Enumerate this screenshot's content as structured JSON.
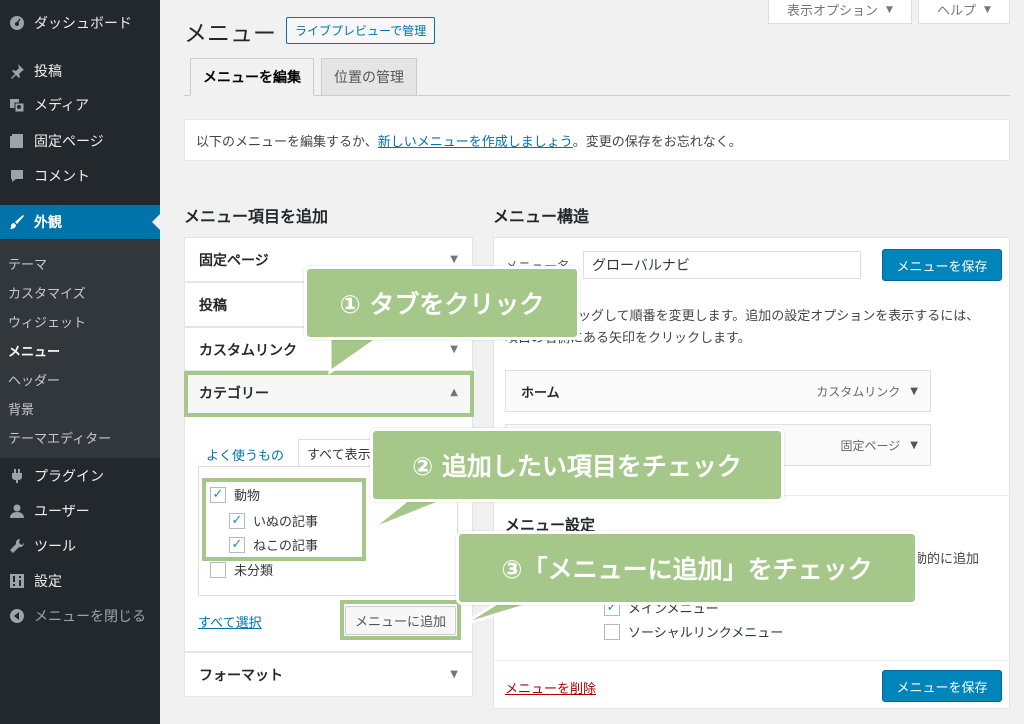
{
  "sidebar": {
    "top_items": [
      {
        "label": "ダッシュボード",
        "icon": "dashboard-icon"
      },
      {
        "label": "投稿",
        "icon": "pin-icon"
      },
      {
        "label": "メディア",
        "icon": "media-icon"
      },
      {
        "label": "固定ページ",
        "icon": "page-icon"
      },
      {
        "label": "コメント",
        "icon": "comment-icon"
      }
    ],
    "active_item": {
      "label": "外観",
      "icon": "brush-icon"
    },
    "submenu": [
      "テーマ",
      "カスタマイズ",
      "ウィジェット",
      "メニュー",
      "ヘッダー",
      "背景",
      "テーマエディター"
    ],
    "current_submenu": "メニュー",
    "bottom_items": [
      {
        "label": "プラグイン",
        "icon": "plugin-icon"
      },
      {
        "label": "ユーザー",
        "icon": "user-icon"
      },
      {
        "label": "ツール",
        "icon": "wrench-icon"
      },
      {
        "label": "設定",
        "icon": "settings-icon"
      },
      {
        "label": "メニューを閉じる",
        "icon": "collapse-icon"
      }
    ]
  },
  "header": {
    "title": "メニュー",
    "live_preview_button": "ライブプレビューで管理",
    "screen_options": "表示オプション",
    "help": "ヘルプ"
  },
  "tabs": {
    "edit": "メニューを編集",
    "locations": "位置の管理"
  },
  "info": {
    "prefix": "以下のメニューを編集するか、",
    "link": "新しいメニューを作成しましょう",
    "suffix": "。変更の保存をお忘れなく。"
  },
  "add_items": {
    "heading": "メニュー項目を追加",
    "sections": [
      "固定ページ",
      "投稿",
      "カスタムリンク",
      "カテゴリー",
      "フォーマット"
    ],
    "inner_tabs": [
      "よく使うもの",
      "すべて表示"
    ],
    "categories": [
      {
        "label": "動物",
        "checked": true
      },
      {
        "label": "いぬの記事",
        "checked": true
      },
      {
        "label": "ねこの記事",
        "checked": true
      },
      {
        "label": "未分類",
        "checked": false
      }
    ],
    "select_all": "すべて選択",
    "add_button": "メニューに追加"
  },
  "structure": {
    "heading": "メニュー構造",
    "name_label": "メニュー名",
    "name_value": "グローバルナビ",
    "save_button": "メニューを保存",
    "instructions": "ラッグして順番を変更します。追加の設定オプションを表示するには、",
    "instructions_line2": "項目の右側にある矢印をクリックします。",
    "items": [
      {
        "title": "ホーム",
        "type": "カスタムリンク"
      },
      {
        "title": "",
        "type": "固定ページ"
      }
    ],
    "settings_heading": "メニュー設定",
    "auto_add_fragment": "動的に追加",
    "locations": [
      {
        "label": "メインメニュー",
        "checked": true
      },
      {
        "label": "ソーシャルリンクメニュー",
        "checked": false
      }
    ],
    "delete_link": "メニューを削除"
  },
  "callouts": {
    "step1": "① タブをクリック",
    "step2": "② 追加したい項目をチェック",
    "step3": "③「メニューに追加」をチェック"
  },
  "colors": {
    "callout_green": "#a5c88a",
    "admin_blue": "#0073aa",
    "sidebar_dark": "#23282d"
  }
}
